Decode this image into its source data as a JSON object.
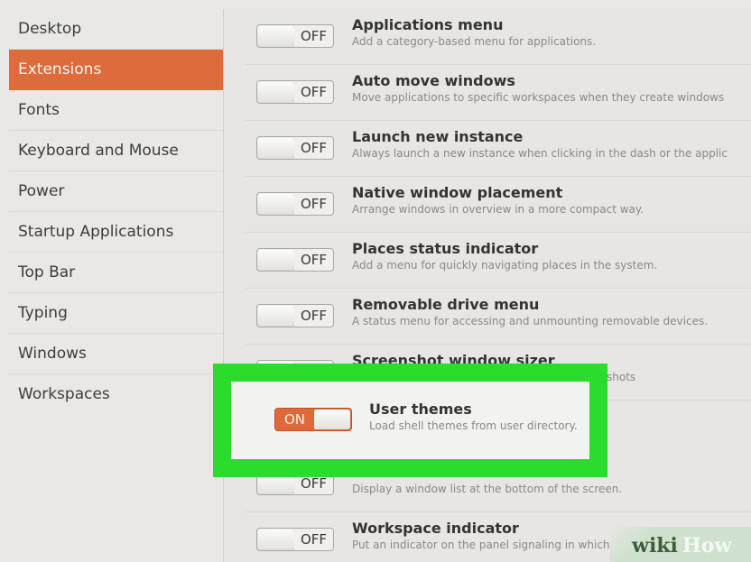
{
  "sidebar": {
    "items": [
      {
        "label": "Desktop",
        "active": false
      },
      {
        "label": "Extensions",
        "active": true
      },
      {
        "label": "Fonts",
        "active": false
      },
      {
        "label": "Keyboard and Mouse",
        "active": false
      },
      {
        "label": "Power",
        "active": false
      },
      {
        "label": "Startup Applications",
        "active": false
      },
      {
        "label": "Top Bar",
        "active": false
      },
      {
        "label": "Typing",
        "active": false
      },
      {
        "label": "Windows",
        "active": false
      },
      {
        "label": "Workspaces",
        "active": false
      }
    ]
  },
  "extensions": [
    {
      "title": "Applications menu",
      "desc": "Add a category-based menu for applications.",
      "state": "OFF"
    },
    {
      "title": "Auto move windows",
      "desc": "Move applications to specific workspaces when they create windows",
      "state": "OFF"
    },
    {
      "title": "Launch new instance",
      "desc": "Always launch a new instance when clicking in the dash or the applic",
      "state": "OFF"
    },
    {
      "title": "Native window placement",
      "desc": "Arrange windows in overview in a more compact way.",
      "state": "OFF"
    },
    {
      "title": "Places status indicator",
      "desc": "Add a menu for quickly navigating places in the system.",
      "state": "OFF"
    },
    {
      "title": "Removable drive menu",
      "desc": "A status menu for accessing and unmounting removable devices.",
      "state": "OFF"
    },
    {
      "title": "Screenshot window sizer",
      "desc": "shots",
      "state": "OFF"
    },
    {
      "title": "",
      "desc": "",
      "state": ""
    },
    {
      "title": "",
      "desc": "Display a window list at the bottom of the screen.",
      "state": "OFF"
    },
    {
      "title": "Workspace indicator",
      "desc": "Put an indicator on the panel signaling in which",
      "state": "OFF"
    }
  ],
  "highlighted": {
    "title": "User themes",
    "desc": "Load shell themes from user directory.",
    "state": "ON"
  },
  "watermark": {
    "text_wiki": "wiki",
    "text_how": "How"
  },
  "colors": {
    "accent": "#dd6b3b",
    "highlight": "#2bdc2c"
  }
}
